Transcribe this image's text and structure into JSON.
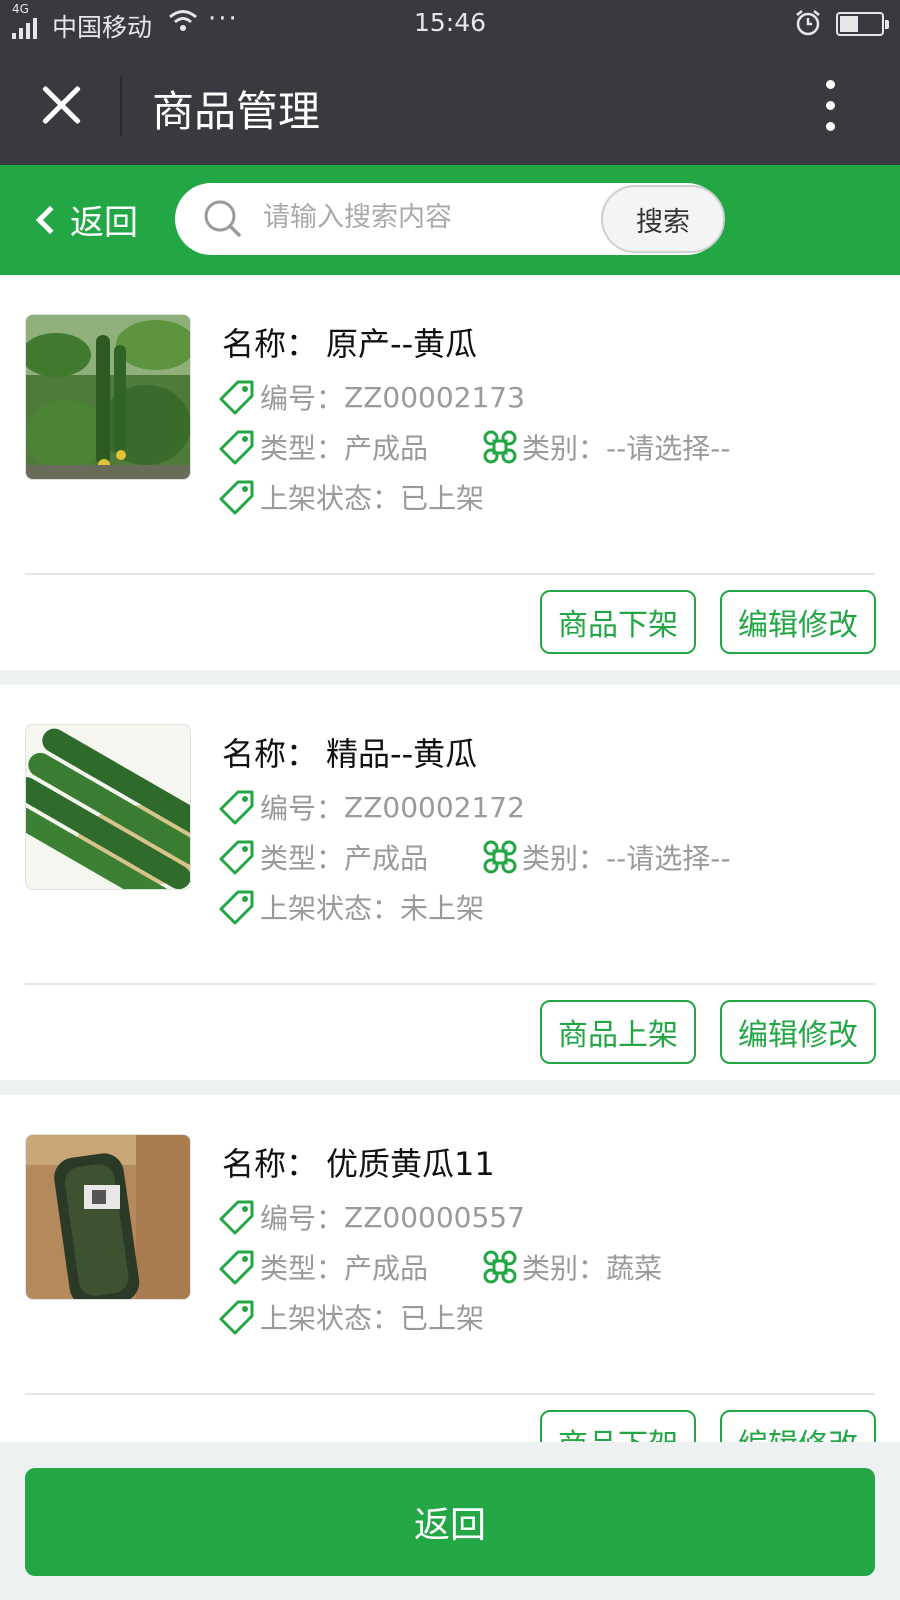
{
  "status_bar": {
    "network": "4G",
    "carrier": "中国移动",
    "time": "15:46",
    "battery_level": 0.45
  },
  "title_bar": {
    "title": "商品管理"
  },
  "search_bar": {
    "back_label": "返回",
    "placeholder": "请输入搜索内容",
    "search_button": "搜索"
  },
  "colors": {
    "accent": "#22a744",
    "header": "#393a3f"
  },
  "labels": {
    "name": "名称：",
    "code": "编号：",
    "type": "类型：",
    "category": "类别：",
    "shelf_status": "上架状态："
  },
  "products": [
    {
      "name": "原产--黄瓜",
      "code": "ZZ00002173",
      "type": "产成品",
      "category": "--请选择--",
      "shelf_status": "已上架",
      "action_primary": "商品下架",
      "action_edit": "编辑修改"
    },
    {
      "name": "精品--黄瓜",
      "code": "ZZ00002172",
      "type": "产成品",
      "category": "--请选择--",
      "shelf_status": "未上架",
      "action_primary": "商品上架",
      "action_edit": "编辑修改"
    },
    {
      "name": "优质黄瓜11",
      "code": "ZZ00000557",
      "type": "产成品",
      "category": "蔬菜",
      "shelf_status": "已上架",
      "action_primary": "商品下架",
      "action_edit": "编辑修改"
    }
  ],
  "bottom_button": "返回"
}
